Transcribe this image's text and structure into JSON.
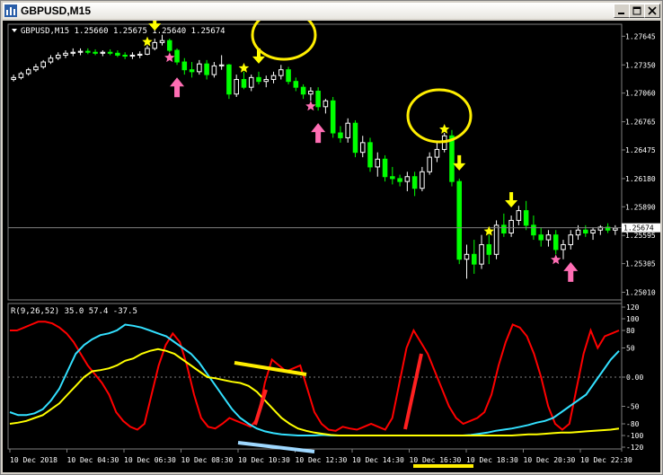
{
  "window": {
    "title": "GBPUSD,M15",
    "buttons": [
      "minimize",
      "maximize",
      "close"
    ]
  },
  "price_panel": {
    "header": "GBPUSD,M15  1.25660 1.25675 1.25640 1.25674",
    "price_labels": [
      "1.27645",
      "1.27350",
      "1.27060",
      "1.26765",
      "1.26475",
      "1.26180",
      "1.25890",
      "1.25595",
      "1.25305",
      "1.25010"
    ],
    "current_price": "1.25674"
  },
  "indicator_panel": {
    "header": "R(9,26,52) 35.0 57.4 -37.5",
    "labels": [
      "120",
      "100",
      "80",
      "50",
      "0.00",
      "-50",
      "-80",
      "-100",
      "-120"
    ]
  },
  "time_labels": [
    "10 Dec 2018",
    "10 Dec 04:30",
    "10 Dec 06:30",
    "10 Dec 08:30",
    "10 Dec 10:30",
    "10 Dec 12:30",
    "10 Dec 14:30",
    "10 Dec 16:30",
    "10 Dec 18:30",
    "10 Dec 20:30",
    "10 Dec 22:30"
  ],
  "colors": {
    "chart_bg": "#000000",
    "bull_candle": "#ffffff",
    "bear_candle": "#00ff00",
    "marker_yellow": "#ffff00",
    "marker_pink": "#ff6eb4",
    "line_red": "#ff0000",
    "line_cyan": "#33e0ff",
    "line_yellow": "#ffff00"
  },
  "chart_data": {
    "type": "line",
    "description_free": true,
    "candles": [
      [
        1.272,
        1.2725,
        1.2718,
        1.2722
      ],
      [
        1.2722,
        1.2728,
        1.272,
        1.2726
      ],
      [
        1.2726,
        1.2732,
        1.2724,
        1.273
      ],
      [
        1.273,
        1.2736,
        1.2728,
        1.2733
      ],
      [
        1.2733,
        1.274,
        1.2731,
        1.2738
      ],
      [
        1.2738,
        1.2745,
        1.2736,
        1.2742
      ],
      [
        1.2742,
        1.2748,
        1.274,
        1.2745
      ],
      [
        1.2745,
        1.275,
        1.2742,
        1.2747
      ],
      [
        1.2747,
        1.2752,
        1.2744,
        1.2748
      ],
      [
        1.2748,
        1.2752,
        1.2745,
        1.2749
      ],
      [
        1.2749,
        1.2752,
        1.2746,
        1.2748
      ],
      [
        1.2748,
        1.2751,
        1.2745,
        1.2747
      ],
      [
        1.2747,
        1.275,
        1.2744,
        1.2748
      ],
      [
        1.2748,
        1.2751,
        1.2745,
        1.2747
      ],
      [
        1.2747,
        1.275,
        1.2743,
        1.2745
      ],
      [
        1.2745,
        1.2748,
        1.2741,
        1.2744
      ],
      [
        1.2744,
        1.2748,
        1.2741,
        1.2745
      ],
      [
        1.2745,
        1.2749,
        1.2742,
        1.2746
      ],
      [
        1.2746,
        1.2755,
        1.2745,
        1.2752
      ],
      [
        1.2752,
        1.2762,
        1.275,
        1.2758
      ],
      [
        1.2758,
        1.2766,
        1.2755,
        1.276
      ],
      [
        1.276,
        1.2762,
        1.2748,
        1.275
      ],
      [
        1.275,
        1.2752,
        1.2735,
        1.2738
      ],
      [
        1.2738,
        1.2742,
        1.2725,
        1.273
      ],
      [
        1.273,
        1.2738,
        1.2722,
        1.2728
      ],
      [
        1.2728,
        1.274,
        1.2725,
        1.2736
      ],
      [
        1.2736,
        1.274,
        1.272,
        1.2725
      ],
      [
        1.2725,
        1.2738,
        1.2722,
        1.2734
      ],
      [
        1.2734,
        1.2745,
        1.273,
        1.2735
      ],
      [
        1.2735,
        1.2736,
        1.27,
        1.2705
      ],
      [
        1.2705,
        1.2725,
        1.2702,
        1.272
      ],
      [
        1.272,
        1.2728,
        1.271,
        1.2712
      ],
      [
        1.2712,
        1.2725,
        1.2708,
        1.2722
      ],
      [
        1.2722,
        1.2728,
        1.2715,
        1.2718
      ],
      [
        1.2718,
        1.2724,
        1.2712,
        1.272
      ],
      [
        1.272,
        1.2728,
        1.2716,
        1.2724
      ],
      [
        1.2724,
        1.2735,
        1.272,
        1.273
      ],
      [
        1.273,
        1.2733,
        1.2715,
        1.2718
      ],
      [
        1.2718,
        1.2722,
        1.2708,
        1.2712
      ],
      [
        1.2712,
        1.2715,
        1.27,
        1.2705
      ],
      [
        1.2705,
        1.2712,
        1.2698,
        1.2708
      ],
      [
        1.2708,
        1.2712,
        1.2688,
        1.2692
      ],
      [
        1.2692,
        1.27,
        1.2685,
        1.2698
      ],
      [
        1.2698,
        1.2702,
        1.266,
        1.2665
      ],
      [
        1.2665,
        1.2672,
        1.2655,
        1.266
      ],
      [
        1.266,
        1.268,
        1.2655,
        1.2675
      ],
      [
        1.2675,
        1.2678,
        1.264,
        1.2645
      ],
      [
        1.2645,
        1.2662,
        1.264,
        1.2655
      ],
      [
        1.2655,
        1.266,
        1.2625,
        1.263
      ],
      [
        1.263,
        1.2645,
        1.262,
        1.2638
      ],
      [
        1.2638,
        1.2642,
        1.2615,
        1.262
      ],
      [
        1.262,
        1.263,
        1.2612,
        1.2618
      ],
      [
        1.2618,
        1.2622,
        1.261,
        1.2615
      ],
      [
        1.2615,
        1.2625,
        1.2605,
        1.262
      ],
      [
        1.262,
        1.2625,
        1.26,
        1.2608
      ],
      [
        1.2608,
        1.263,
        1.2605,
        1.2625
      ],
      [
        1.2625,
        1.2645,
        1.2622,
        1.264
      ],
      [
        1.264,
        1.2655,
        1.2635,
        1.2648
      ],
      [
        1.2648,
        1.2665,
        1.2645,
        1.2662
      ],
      [
        1.2662,
        1.2668,
        1.261,
        1.2615
      ],
      [
        1.2615,
        1.2618,
        1.253,
        1.2535
      ],
      [
        1.2535,
        1.255,
        1.2515,
        1.254
      ],
      [
        1.254,
        1.2555,
        1.252,
        1.253
      ],
      [
        1.253,
        1.256,
        1.2525,
        1.255
      ],
      [
        1.255,
        1.256,
        1.253,
        1.254
      ],
      [
        1.254,
        1.2575,
        1.2535,
        1.257
      ],
      [
        1.257,
        1.2582,
        1.2558,
        1.2562
      ],
      [
        1.2562,
        1.258,
        1.2558,
        1.2575
      ],
      [
        1.2575,
        1.259,
        1.257,
        1.2585
      ],
      [
        1.2585,
        1.2595,
        1.2565,
        1.257
      ],
      [
        1.257,
        1.258,
        1.2555,
        1.256
      ],
      [
        1.256,
        1.2568,
        1.2548,
        1.2555
      ],
      [
        1.2555,
        1.2565,
        1.2548,
        1.256
      ],
      [
        1.256,
        1.2565,
        1.254,
        1.2545
      ],
      [
        1.2545,
        1.2555,
        1.2535,
        1.255
      ],
      [
        1.255,
        1.2565,
        1.2545,
        1.256
      ],
      [
        1.256,
        1.257,
        1.2555,
        1.2565
      ],
      [
        1.2565,
        1.257,
        1.2558,
        1.2562
      ],
      [
        1.2562,
        1.2568,
        1.2555,
        1.2565
      ],
      [
        1.2565,
        1.257,
        1.256,
        1.2568
      ],
      [
        1.2568,
        1.2572,
        1.2562,
        1.2565
      ],
      [
        1.2565,
        1.257,
        1.256,
        1.2567
      ]
    ],
    "ylim": [
      1.2495,
      1.2775
    ],
    "indicator": {
      "ylim": [
        -120,
        120
      ],
      "series": [
        {
          "values": [
            80,
            80,
            85,
            90,
            95,
            95,
            92,
            85,
            75,
            60,
            40,
            20,
            5,
            -10,
            -30,
            -60,
            -75,
            -85,
            -90,
            -80,
            -30,
            20,
            55,
            75,
            60,
            20,
            -30,
            -70,
            -85,
            -88,
            -80,
            -70,
            -75,
            -80,
            -85,
            -70,
            -10,
            30,
            20,
            10,
            15,
            20,
            -20,
            -60,
            -80,
            -90,
            -92,
            -85,
            -88,
            -90,
            -85,
            -80,
            -85,
            -90,
            -70,
            -10,
            50,
            80,
            60,
            40,
            10,
            -20,
            -50,
            -70,
            -80,
            -75,
            -70,
            -60,
            -30,
            20,
            60,
            90,
            85,
            70,
            40,
            0,
            -50,
            -80,
            -90,
            -80,
            -20,
            40,
            80,
            50,
            70,
            75,
            80
          ]
        },
        {
          "values": [
            -60,
            -65,
            -65,
            -62,
            -55,
            -40,
            -20,
            10,
            40,
            55,
            65,
            72,
            75,
            80,
            90,
            88,
            85,
            80,
            75,
            70,
            60,
            50,
            40,
            25,
            5,
            -15,
            -35,
            -55,
            -70,
            -80,
            -88,
            -93,
            -96,
            -98,
            -99,
            -100,
            -100,
            -100,
            -99,
            -100,
            -100,
            -100,
            -100,
            -100,
            -100,
            -100,
            -100,
            -100,
            -100,
            -100,
            -100,
            -100,
            -100,
            -100,
            -100,
            -100,
            -99,
            -97,
            -95,
            -92,
            -90,
            -88,
            -85,
            -82,
            -78,
            -75,
            -70,
            -60,
            -50,
            -40,
            -30,
            -10,
            10,
            30,
            45
          ]
        },
        {
          "values": [
            -80,
            -78,
            -75,
            -70,
            -65,
            -55,
            -45,
            -30,
            -15,
            0,
            10,
            12,
            15,
            20,
            28,
            32,
            40,
            45,
            48,
            45,
            40,
            30,
            20,
            10,
            0,
            -2,
            -5,
            -8,
            -10,
            -15,
            -25,
            -40,
            -55,
            -70,
            -80,
            -88,
            -92,
            -95,
            -97,
            -99,
            -100,
            -100,
            -100,
            -100,
            -100,
            -100,
            -100,
            -100,
            -100,
            -100,
            -100,
            -100,
            -100,
            -100,
            -100,
            -100,
            -100,
            -100,
            -100,
            -100,
            -100,
            -100,
            -99,
            -98,
            -98,
            -97,
            -96,
            -95,
            -95,
            -94,
            -93,
            -92,
            -91,
            -90,
            -88
          ]
        }
      ]
    },
    "signals": {
      "yellow_stars": [
        18,
        31,
        58,
        64
      ],
      "yellow_arrows_down": [
        19,
        33,
        60,
        67
      ],
      "pink_stars": [
        21,
        40,
        73
      ],
      "pink_arrows_up": [
        22,
        41,
        75
      ]
    }
  }
}
